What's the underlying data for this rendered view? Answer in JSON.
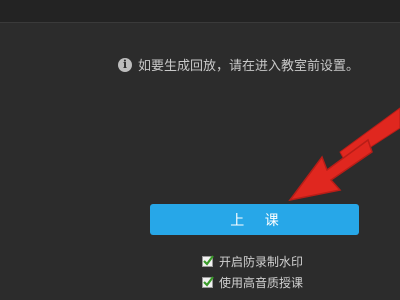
{
  "notice": {
    "icon": "info-icon",
    "text": "如要生成回放，请在进入教室前设置。"
  },
  "start_button": {
    "label": "上 课",
    "color": "#27a7e8"
  },
  "options": [
    {
      "label": "开启防录制水印",
      "checked": true
    },
    {
      "label": "使用高音质授课",
      "checked": true
    }
  ],
  "annotation": {
    "icon": "red-arrow-icon",
    "color": "#e0271f"
  }
}
